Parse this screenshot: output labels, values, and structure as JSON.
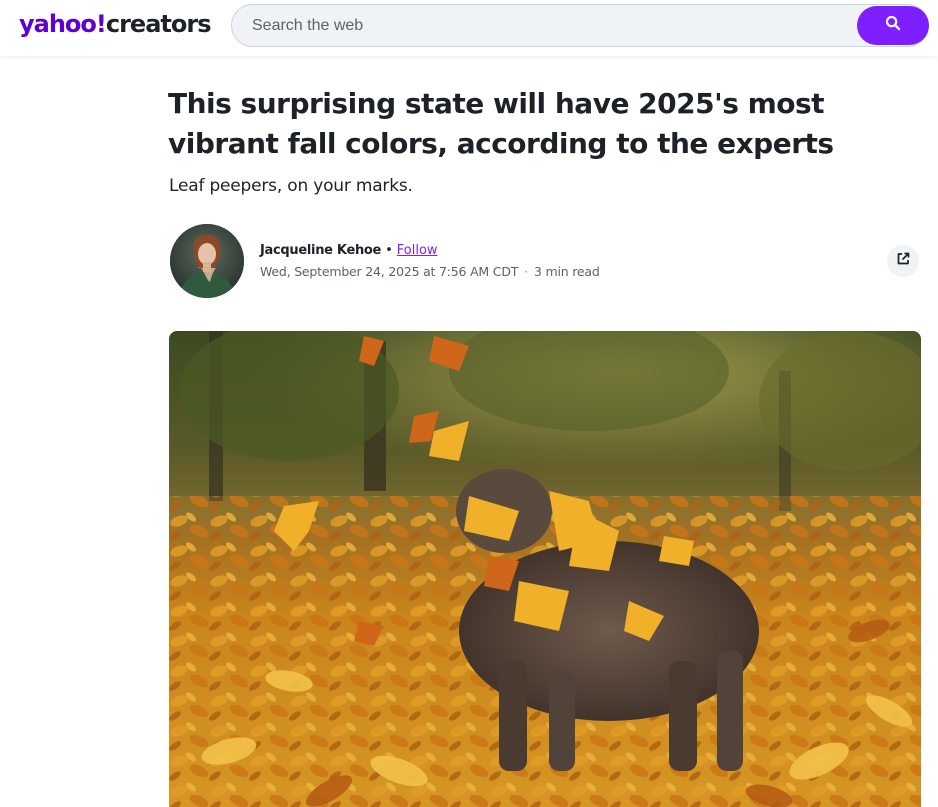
{
  "header": {
    "logo_brand": "yahoo!",
    "logo_sub": "creators",
    "search_placeholder": "Search the web",
    "search_icon": "search-icon"
  },
  "article": {
    "title": "This surprising state will have 2025's most vibrant fall colors, according to the experts",
    "subtitle": "Leaf peepers, on your marks.",
    "author": {
      "name": "Jacqueline Kehoe",
      "separator": "•",
      "follow_label": "Follow",
      "date": "Wed, September 24, 2025 at 7:56 AM CDT",
      "meta_separator": "·",
      "read_time": "3 min read"
    },
    "share_icon": "external-share-icon",
    "hero_image": "dog-playing-in-autumn-leaves"
  },
  "colors": {
    "brand_purple": "#6001d2",
    "accent_purple": "#7e1fff",
    "text_primary": "#1d2228",
    "text_secondary": "#5b636a"
  }
}
